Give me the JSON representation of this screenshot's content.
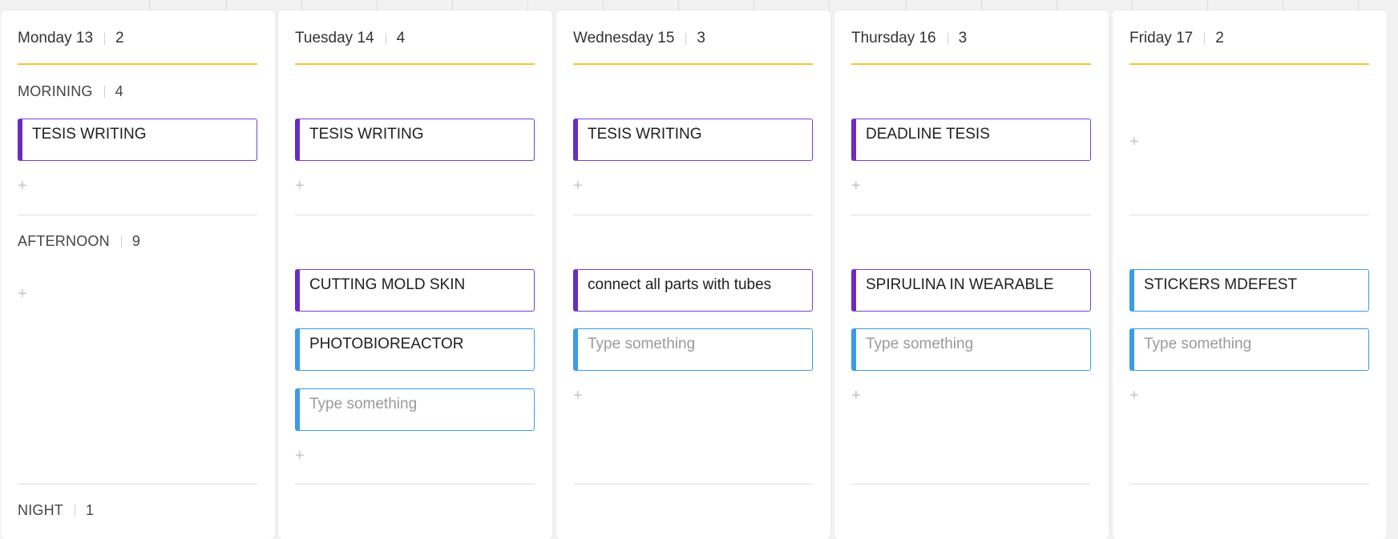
{
  "columns": [
    {
      "day": "Monday 13",
      "count": "2",
      "sections": {
        "morning": {
          "label": "MORINING",
          "count": "4"
        },
        "afternoon": {
          "label": "AFTERNOON",
          "count": "9"
        },
        "night": {
          "label": "NIGHT",
          "count": "1"
        }
      },
      "morning_cards": [
        {
          "text": "TESIS WRITING",
          "color": "purple"
        }
      ],
      "afternoon_cards": []
    },
    {
      "day": "Tuesday 14",
      "count": "4",
      "morning_cards": [
        {
          "text": "TESIS WRITING",
          "color": "purple"
        }
      ],
      "afternoon_cards": [
        {
          "text": "CUTTING MOLD SKIN",
          "color": "purple"
        },
        {
          "text": "PHOTOBIOREACTOR",
          "color": "blue"
        },
        {
          "placeholder": "Type something",
          "color": "blue"
        }
      ]
    },
    {
      "day": "Wednesday 15",
      "count": "3",
      "morning_cards": [
        {
          "text": "TESIS WRITING",
          "color": "purple"
        }
      ],
      "afternoon_cards": [
        {
          "text": "connect all parts with tubes",
          "color": "purple"
        },
        {
          "placeholder": "Type something",
          "color": "blue"
        }
      ]
    },
    {
      "day": "Thursday 16",
      "count": "3",
      "morning_cards": [
        {
          "text": "DEADLINE TESIS",
          "color": "purple"
        }
      ],
      "afternoon_cards": [
        {
          "text": "SPIRULINA IN WEARABLE",
          "color": "purple"
        },
        {
          "placeholder": "Type something",
          "color": "blue"
        }
      ]
    },
    {
      "day": "Friday 17",
      "count": "2",
      "morning_cards": [],
      "afternoon_cards": [
        {
          "text": "STICKERS MDEFEST",
          "color": "blue"
        },
        {
          "placeholder": "Type something",
          "color": "blue"
        }
      ]
    }
  ],
  "add_symbol": "+",
  "colors": {
    "accent_yellow": "#f5c330",
    "purple": "#6a2cc0",
    "blue": "#3a9bea"
  }
}
